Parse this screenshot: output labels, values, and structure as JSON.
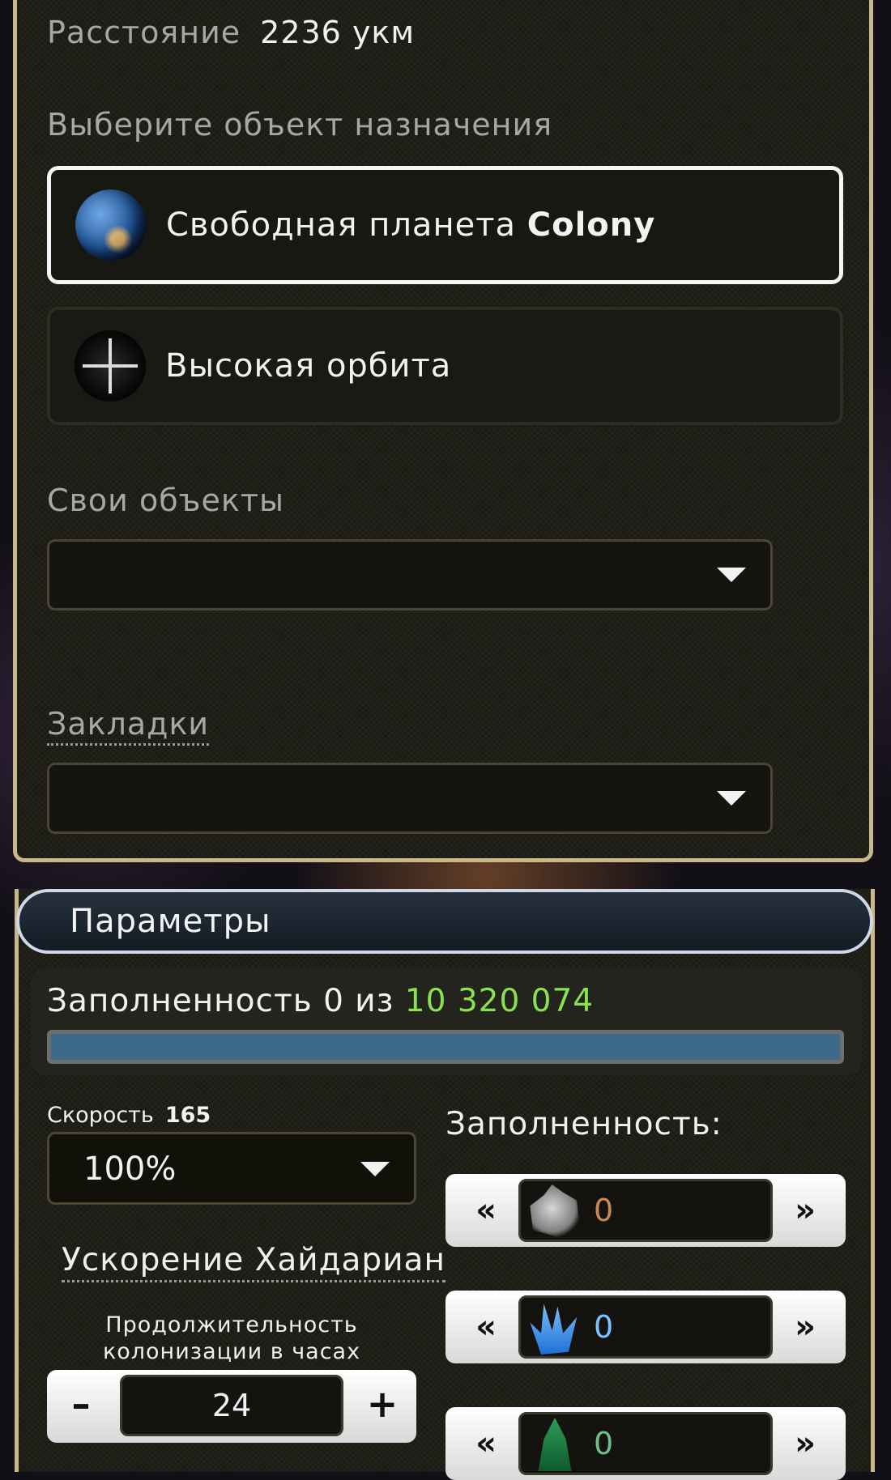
{
  "distance": {
    "label": "Расстояние",
    "value": "2236 укм"
  },
  "destination": {
    "prompt": "Выберите объект назначения",
    "options": [
      {
        "label": "Свободная планета",
        "bold": "Colony",
        "icon": "planet-icon",
        "selected": true
      },
      {
        "label": "Высокая орбита",
        "bold": "",
        "icon": "orbit-crosshair-icon",
        "selected": false
      }
    ]
  },
  "own_objects": {
    "label": "Свои объекты",
    "value": ""
  },
  "bookmarks": {
    "label": "Закладки",
    "value": ""
  },
  "params": {
    "title": "Параметры",
    "capacity": {
      "prefix": "Заполненность 0 из",
      "max": "10 320 074",
      "fill_fraction": 0
    },
    "speed": {
      "label": "Скорость",
      "value": "165",
      "selected": "100%"
    },
    "boost_label": "Ускорение Хайдариан",
    "duration": {
      "label": "Продолжительность колонизации в часах",
      "value": "24",
      "minus": "–",
      "plus": "+"
    },
    "fill_label": "Заполненность:",
    "resources": [
      {
        "icon": "metal-icon",
        "value": "0",
        "left": "«",
        "right": "»"
      },
      {
        "icon": "crystal-icon",
        "value": "0",
        "left": "«",
        "right": "»"
      },
      {
        "icon": "deuterium-icon",
        "value": "0",
        "left": "«",
        "right": "»"
      }
    ]
  }
}
